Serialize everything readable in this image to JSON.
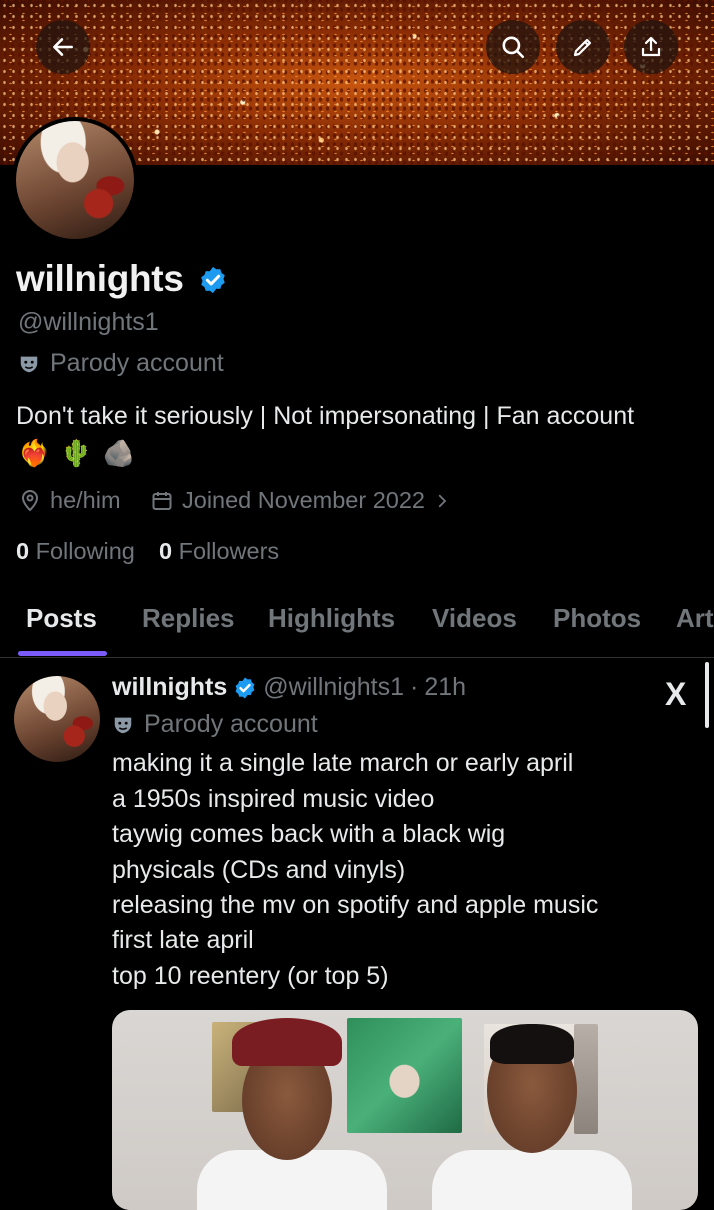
{
  "profile": {
    "name": "willnights",
    "handle": "@willnights1",
    "parody_label": "Parody account",
    "bio": "Don't take it seriously | Not impersonating | Fan account",
    "bio_emojis": [
      "❤️‍🔥",
      "🌵",
      "🪨"
    ],
    "pronouns": "he/him",
    "joined": "Joined November 2022",
    "following_count": "0",
    "following_label": "Following",
    "followers_count": "0",
    "followers_label": "Followers",
    "verified_color": "#1d9bf0"
  },
  "header_buttons": [
    "back-arrow-icon",
    "search-icon",
    "edit-pencil-icon",
    "share-icon"
  ],
  "tabs": [
    {
      "label": "Posts",
      "active": true
    },
    {
      "label": "Replies",
      "active": false
    },
    {
      "label": "Highlights",
      "active": false
    },
    {
      "label": "Videos",
      "active": false
    },
    {
      "label": "Photos",
      "active": false
    },
    {
      "label": "Art",
      "active": false
    }
  ],
  "accent_color": "#7b5cfa",
  "post": {
    "name": "willnights",
    "handle": "@willnights1",
    "separator": "·",
    "time": "21h",
    "parody_label": "Parody account",
    "lines": [
      "making it a single late march or early april",
      "a 1950s inspired music video",
      "taywig comes back with a black wig",
      "physicals (CDs and vinyls)",
      "releasing the mv on spotify and apple music",
      "first late april",
      "top 10 reentery (or top 5)"
    ],
    "source_logo": "X"
  }
}
